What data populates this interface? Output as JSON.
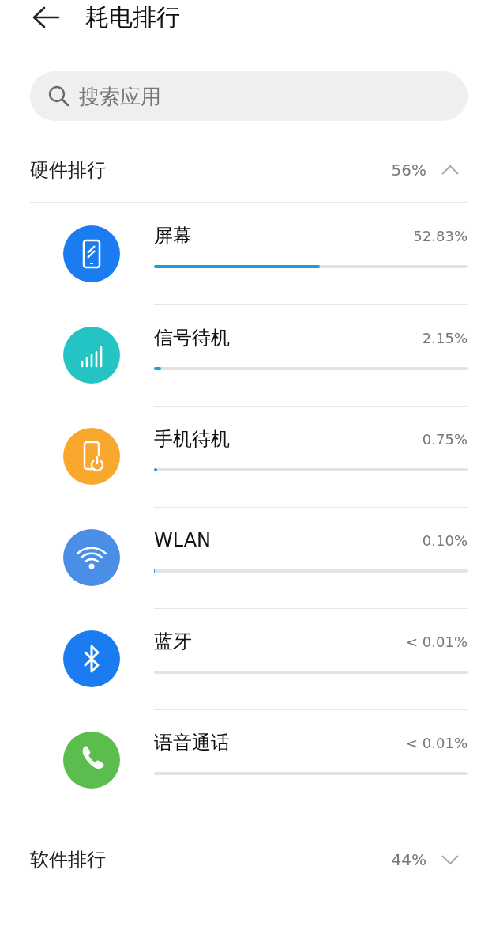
{
  "header": {
    "title": "耗电排行"
  },
  "search": {
    "placeholder": "搜索应用"
  },
  "sections": [
    {
      "title": "硬件排行",
      "percent": "56%",
      "expanded": true,
      "items": [
        {
          "name": "屏幕",
          "reading": "52.83%",
          "level": 0.5283,
          "kind": "screen",
          "color": "#1a7cf0"
        },
        {
          "name": "信号待机",
          "reading": "2.15%",
          "level": 0.0215,
          "kind": "signal",
          "color": "#25c4c4"
        },
        {
          "name": "手机待机",
          "reading": "0.75%",
          "level": 0.0075,
          "kind": "standby",
          "color": "#f9a72d"
        },
        {
          "name": "WLAN",
          "reading": "0.10%",
          "level": 0.001,
          "kind": "wifi",
          "color": "#4a8ee6"
        },
        {
          "name": "蓝牙",
          "reading": "< 0.01%",
          "level": 0.0001,
          "kind": "bluetooth",
          "color": "#1a7cf0"
        },
        {
          "name": "语音通话",
          "reading": "< 0.01%",
          "level": 0.0001,
          "kind": "call",
          "color": "#5cbd4f"
        }
      ]
    },
    {
      "title": "软件排行",
      "percent": "44%",
      "expanded": false
    }
  ]
}
